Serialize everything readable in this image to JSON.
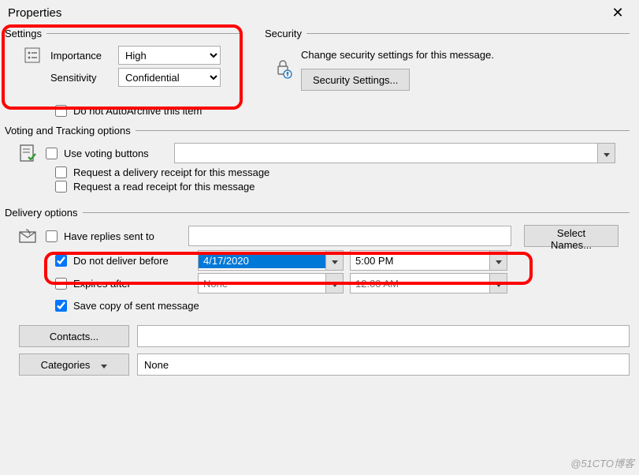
{
  "window": {
    "title": "Properties"
  },
  "settings": {
    "legend": "Settings",
    "importance_label": "Importance",
    "importance_value": "High",
    "sensitivity_label": "Sensitivity",
    "sensitivity_value": "Confidential",
    "autoarchive_label": "Do not AutoArchive this item",
    "autoarchive_checked": false
  },
  "security": {
    "legend": "Security",
    "text": "Change security settings for this message.",
    "button": "Security Settings..."
  },
  "voting": {
    "legend": "Voting and Tracking options",
    "use_voting_label": "Use voting buttons",
    "use_voting_checked": false,
    "voting_value": "",
    "delivery_receipt_label": "Request a delivery receipt for this message",
    "delivery_receipt_checked": false,
    "read_receipt_label": "Request a read receipt for this message",
    "read_receipt_checked": false
  },
  "delivery": {
    "legend": "Delivery options",
    "replies_label": "Have replies sent to",
    "replies_checked": false,
    "replies_value": "",
    "select_names_button": "Select Names...",
    "nodeliver_label": "Do not deliver before",
    "nodeliver_checked": true,
    "nodeliver_date": "4/17/2020",
    "nodeliver_time": "5:00 PM",
    "expires_label": "Expires after",
    "expires_checked": false,
    "expires_date": "None",
    "expires_time": "12:00 AM",
    "savecopy_label": "Save copy of sent message",
    "savecopy_checked": true
  },
  "bottom": {
    "contacts_button": "Contacts...",
    "contacts_value": "",
    "categories_button": "Categories",
    "categories_value": "None"
  },
  "watermark": "@51CTO博客"
}
